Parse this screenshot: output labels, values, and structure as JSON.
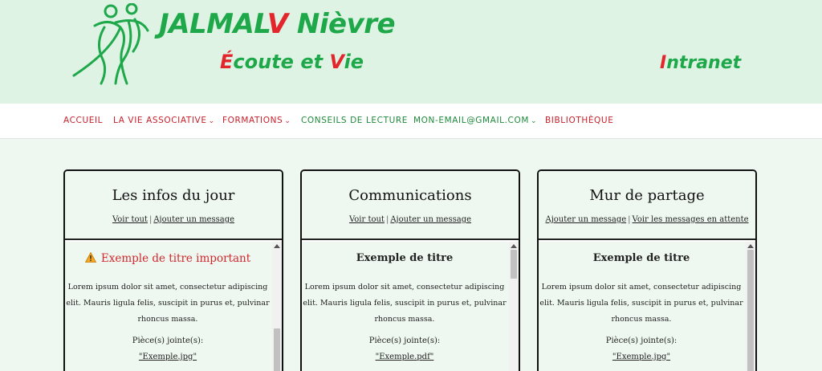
{
  "header": {
    "brand_main": "JALMAL",
    "brand_v": "V",
    "brand_region": " Nièvre",
    "tagline_e": "É",
    "tagline_mid": "coute et ",
    "tagline_v": "V",
    "tagline_end": "ie",
    "intranet_i": "I",
    "intranet_rest": "ntranet",
    "colors": {
      "green": "#1ea84a",
      "red": "#e2262b",
      "header_bg": "#dff3e4"
    }
  },
  "nav": {
    "items": [
      {
        "label": "ACCUEIL",
        "has_caret": false
      },
      {
        "label": "LA VIE ASSOCIATIVE",
        "has_caret": true
      },
      {
        "label": "FORMATIONS",
        "has_caret": true
      },
      {
        "label": "CONSEILS DE LECTURE",
        "has_caret": false
      },
      {
        "label": "MON-EMAIL@GMAIL.COM",
        "has_caret": true
      },
      {
        "label": "BIBLIOTHÈQUE",
        "has_caret": false
      }
    ],
    "caret_icon": "chevron-down-icon"
  },
  "cards": [
    {
      "title": "Les infos du jour",
      "link1": "Voir tout",
      "separator": "|",
      "link2": "Ajouter un message",
      "message": {
        "title": "Exemple de titre important",
        "important": true,
        "icon": "warning-icon",
        "text": "Lorem ipsum dolor sit amet, consectetur adipiscing elit. Mauris ligula felis, suscipit in purus et, pulvinar rhoncus massa.",
        "attachment_label": "Pièce(s) jointe(s):",
        "attachment_file": "\"Exemple.jpg\""
      }
    },
    {
      "title": "Communications",
      "link1": "Voir tout",
      "separator": "|",
      "link2": "Ajouter un message",
      "message": {
        "title": "Exemple de titre",
        "important": false,
        "text": "Lorem ipsum dolor sit amet, consectetur adipiscing elit. Mauris ligula felis, suscipit in purus et, pulvinar rhoncus massa.",
        "attachment_label": "Pièce(s) jointe(s):",
        "attachment_file": "\"Exemple.pdf\""
      }
    },
    {
      "title": "Mur de partage",
      "link1": "Ajouter un message",
      "separator": "|",
      "link2": "Voir les messages en attente",
      "message": {
        "title": "Exemple de titre",
        "important": false,
        "text": "Lorem ipsum dolor sit amet, consectetur adipiscing elit. Mauris ligula felis, suscipit in purus et, pulvinar rhoncus massa.",
        "attachment_label": "Pièce(s) jointe(s):",
        "attachment_file": "\"Exemple.jpg\""
      }
    }
  ]
}
